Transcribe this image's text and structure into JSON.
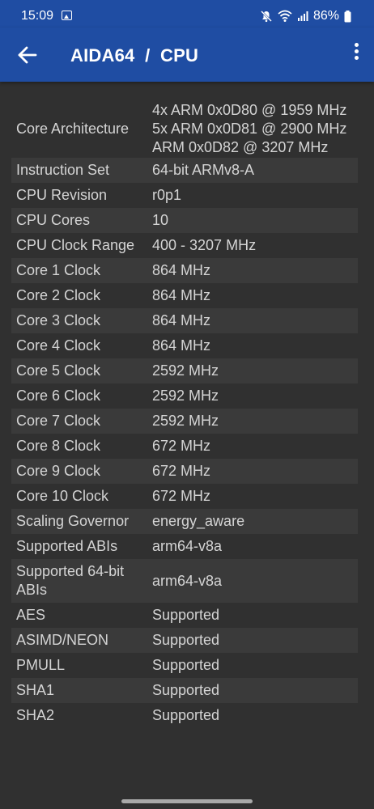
{
  "status": {
    "time": "15:09",
    "battery": "86%"
  },
  "header": {
    "title": "AIDA64  /  CPU"
  },
  "rows": [
    {
      "label": "Core Architecture",
      "values": [
        "4x ARM 0x0D80 @ 1959 MHz",
        "5x ARM 0x0D81 @ 2900 MHz",
        "ARM 0x0D82 @ 3207 MHz"
      ]
    },
    {
      "label": "Instruction Set",
      "values": [
        "64-bit ARMv8-A"
      ]
    },
    {
      "label": "CPU Revision",
      "values": [
        "r0p1"
      ]
    },
    {
      "label": "CPU Cores",
      "values": [
        "10"
      ]
    },
    {
      "label": "CPU Clock Range",
      "values": [
        "400 - 3207 MHz"
      ]
    },
    {
      "label": "Core 1 Clock",
      "values": [
        "864 MHz"
      ]
    },
    {
      "label": "Core 2 Clock",
      "values": [
        "864 MHz"
      ]
    },
    {
      "label": "Core 3 Clock",
      "values": [
        "864 MHz"
      ]
    },
    {
      "label": "Core 4 Clock",
      "values": [
        "864 MHz"
      ]
    },
    {
      "label": "Core 5 Clock",
      "values": [
        "2592 MHz"
      ]
    },
    {
      "label": "Core 6 Clock",
      "values": [
        "2592 MHz"
      ]
    },
    {
      "label": "Core 7 Clock",
      "values": [
        "2592 MHz"
      ]
    },
    {
      "label": "Core 8 Clock",
      "values": [
        "672 MHz"
      ]
    },
    {
      "label": "Core 9 Clock",
      "values": [
        "672 MHz"
      ]
    },
    {
      "label": "Core 10 Clock",
      "values": [
        "672 MHz"
      ]
    },
    {
      "label": "Scaling Governor",
      "values": [
        "energy_aware"
      ]
    },
    {
      "label": "Supported ABIs",
      "values": [
        "arm64-v8a"
      ]
    },
    {
      "label": "Supported 64-bit ABIs",
      "values": [
        "arm64-v8a"
      ]
    },
    {
      "label": "AES",
      "values": [
        "Supported"
      ]
    },
    {
      "label": "ASIMD/NEON",
      "values": [
        "Supported"
      ]
    },
    {
      "label": "PMULL",
      "values": [
        "Supported"
      ]
    },
    {
      "label": "SHA1",
      "values": [
        "Supported"
      ]
    },
    {
      "label": "SHA2",
      "values": [
        "Supported"
      ]
    }
  ],
  "icons": {
    "back": "arrow-left-icon",
    "menu": "more-vert-icon",
    "mute": "mute-icon",
    "wifi": "wifi-icon",
    "signal": "signal-icon",
    "battery": "battery-icon",
    "gallery": "gallery-icon"
  },
  "colors": {
    "app_bar": "#1f4da3",
    "background": "#303030",
    "row_alt": "#3a3a3a",
    "text": "#d4d4d4"
  }
}
